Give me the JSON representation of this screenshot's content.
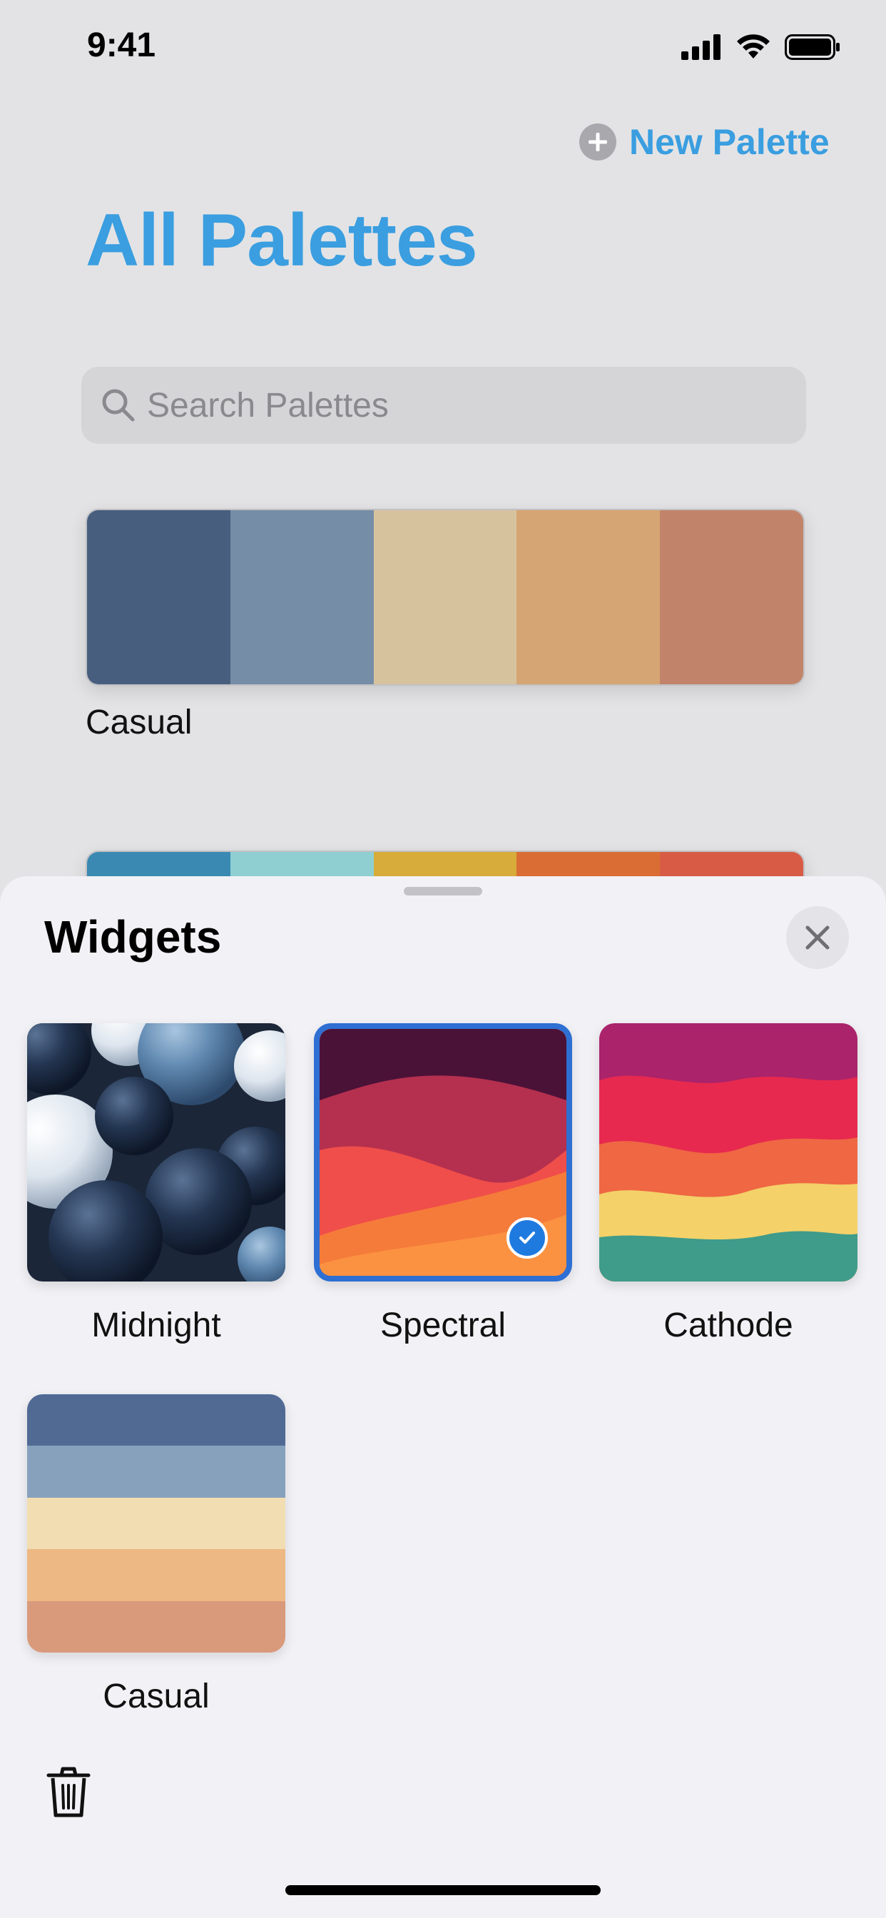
{
  "status_bar": {
    "time": "9:41"
  },
  "header": {
    "new_palette_label": "New Palette",
    "title": "All Palettes"
  },
  "search": {
    "placeholder": "Search Palettes"
  },
  "palettes": [
    {
      "name": "Casual",
      "colors": [
        "#475e7f",
        "#758da6",
        "#d7c29e",
        "#d6a574",
        "#c1846b"
      ]
    },
    {
      "name": "",
      "colors": [
        "#3a89b3",
        "#8fcfd2",
        "#d8ac3a",
        "#d96d33",
        "#d85b45"
      ]
    }
  ],
  "sheet": {
    "title": "Widgets",
    "widgets": [
      {
        "label": "Midnight",
        "selected": false
      },
      {
        "label": "Spectral",
        "selected": true
      },
      {
        "label": "Cathode",
        "selected": false
      },
      {
        "label": "Casual",
        "selected": false,
        "colors": [
          "#506a94",
          "#87a1bd",
          "#f2ddb2",
          "#edb883",
          "#d99a7c"
        ]
      }
    ]
  },
  "colors": {
    "accent": "#3a9ee0",
    "selection": "#2e6fd3"
  }
}
